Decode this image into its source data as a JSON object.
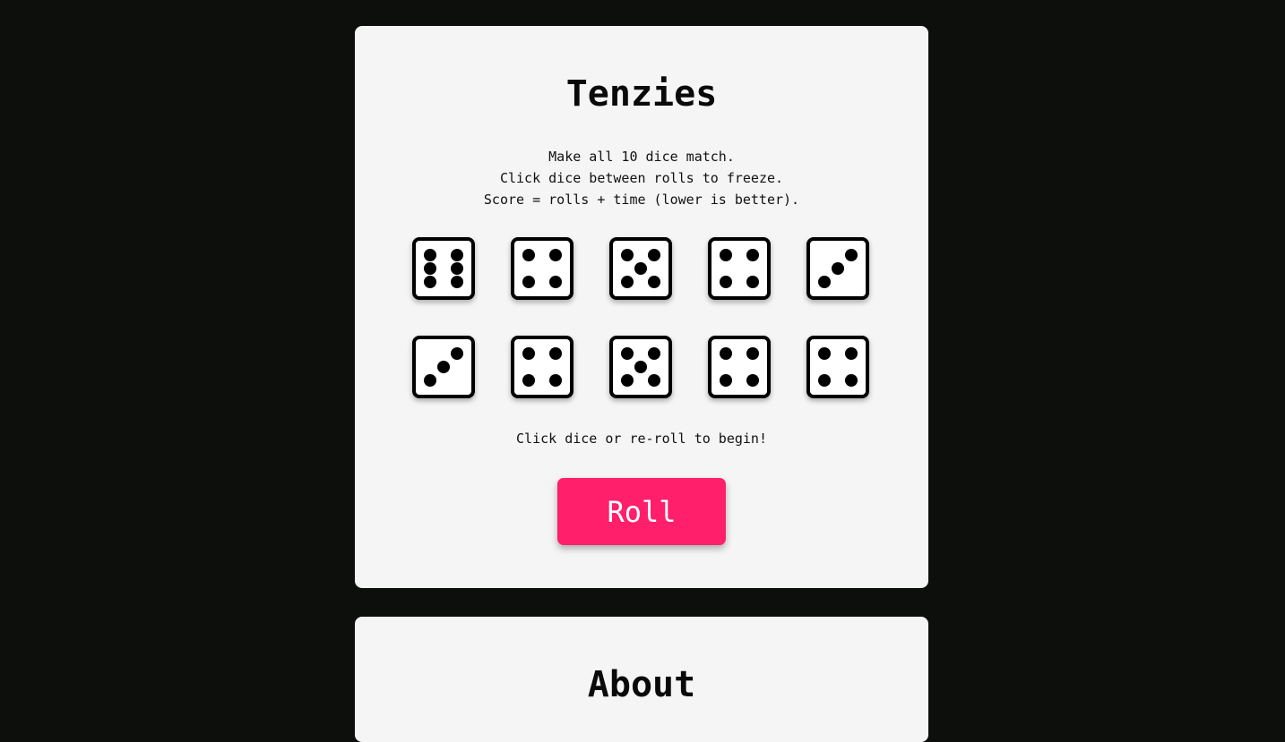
{
  "game": {
    "title": "Tenzies",
    "instructions": [
      "Make all 10 dice match.",
      "Click dice between rolls to freeze.",
      "Score = rolls + time (lower is better)."
    ],
    "dice": [
      {
        "value": 6,
        "frozen": false
      },
      {
        "value": 4,
        "frozen": false
      },
      {
        "value": 5,
        "frozen": false
      },
      {
        "value": 4,
        "frozen": false
      },
      {
        "value": 3,
        "frozen": false
      },
      {
        "value": 3,
        "frozen": false
      },
      {
        "value": 4,
        "frozen": false
      },
      {
        "value": 5,
        "frozen": false
      },
      {
        "value": 4,
        "frozen": false
      },
      {
        "value": 4,
        "frozen": false
      }
    ],
    "status": "Click dice or re-roll to begin!",
    "roll_label": "Roll"
  },
  "about": {
    "title": "About"
  },
  "colors": {
    "page_background": "#0c0f0b",
    "card_background": "#f5f5f5",
    "accent": "#ff1f6b"
  }
}
